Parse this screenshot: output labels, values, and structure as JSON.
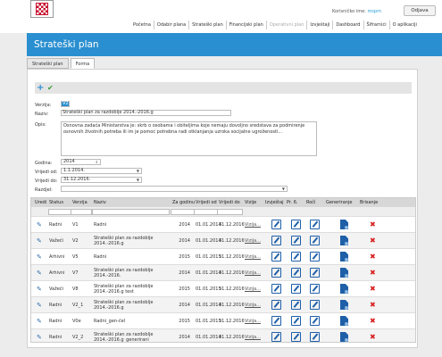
{
  "header": {
    "user_label": "Korisničko ime:",
    "user_name": "mspm",
    "logout": "Odjava",
    "nav": [
      "Početna",
      "Odabir plana",
      "Strateški plan",
      "Financijski plan",
      "Operativni plan",
      "Izvještaji",
      "Dashboard",
      "Šifrarnici",
      "O aplikaciji"
    ],
    "nav_disabled_index": 4
  },
  "page_title": "Strateški plan",
  "tabs": [
    {
      "label": "Strateški plan",
      "active": false
    },
    {
      "label": "Forma",
      "active": true
    }
  ],
  "form": {
    "verzija_label": "Verzija:",
    "verzija_value": "V2",
    "naziv_label": "Naziv:",
    "naziv_value": "Strateški plan za razdoblje 2014.-2016.g",
    "opis_label": "Opis:",
    "opis_value": "Osnovna zadaća Ministarstva je: skrb o osobama i obiteljima koje nemaju dovoljno sredstava za podmirenje osnovnih životnih potreba ili im je pomoć potrebna radi otklanjanja uzroka socijalne ugroženosti...",
    "godina_label": "Godina:",
    "godina_value": "2014",
    "od_label": "Vrijedi od:",
    "od_value": "1.1.2014.",
    "do_label": "Vrijedi do:",
    "do_value": "31.12.2016.",
    "razdjel_label": "Razdjel:",
    "razdjel_value": ""
  },
  "grid": {
    "columns": [
      "Uredi",
      "Status",
      "Verzija",
      "Naziv",
      "Za godinu",
      "Vrijedi od",
      "Vrijedi do",
      "Vizije",
      "Izvještaj",
      "Pr. 6.",
      "Ročí",
      "Generiranje",
      "Brisanje"
    ],
    "rows": [
      {
        "status": "Radni",
        "verzija": "V1",
        "naziv": "Radni",
        "godina": "2014",
        "od": "01.01.2014",
        "do": "31.12.2016",
        "vizije": "Vizija..."
      },
      {
        "status": "Važeći",
        "verzija": "V2",
        "naziv": "Strateški plan za razdoblje 2014.-2016.g",
        "godina": "2014",
        "od": "01.01.2014",
        "do": "31.12.2016",
        "vizije": "Vizija..."
      },
      {
        "status": "Arhivni",
        "verzija": "V5",
        "naziv": "Radni",
        "godina": "2015",
        "od": "01.01.2015",
        "do": "31.12.2016",
        "vizije": "Vizija..."
      },
      {
        "status": "Arhivni",
        "verzija": "V7",
        "naziv": "Strateški plan za razdoblje 2014.-2016.",
        "godina": "2014",
        "od": "01.01.2014",
        "do": "31.12.2016",
        "vizije": "Vizija..."
      },
      {
        "status": "Važeći",
        "verzija": "V8",
        "naziv": "Strateški plan za razdoblje 2014.-2016.g test",
        "godina": "2015",
        "od": "01.01.2015",
        "do": "31.12.2016",
        "vizije": "Vizija..."
      },
      {
        "status": "Radni",
        "verzija": "V2_1",
        "naziv": "Strateški plan za razdoblje 2014.-2016.g",
        "godina": "2014",
        "od": "01.01.2014",
        "do": "31.12.2016",
        "vizije": "Vizija..."
      },
      {
        "status": "Radni",
        "verzija": "V0e",
        "naziv": "Radni_gen-čel",
        "godina": "2015",
        "od": "01.01.2015",
        "do": "31.12.2016",
        "vizije": "Vizija..."
      },
      {
        "status": "Radni",
        "verzija": "V2_2",
        "naziv": "Strateški plan za razdoblje 2014.-2016.g_generirani",
        "godina": "2014",
        "od": "01.01.2014",
        "do": "31.12.2016",
        "vizije": "Vizija..."
      }
    ]
  },
  "icons": {
    "add": "plus-icon",
    "save": "check-icon",
    "edit": "pencil-icon",
    "report": "edit-box-icon",
    "generate": "document-icon",
    "delete": "delete-icon"
  },
  "colors": {
    "accent": "#2a8fd0",
    "delete": "#d62020",
    "icon": "#1f5fa8"
  }
}
